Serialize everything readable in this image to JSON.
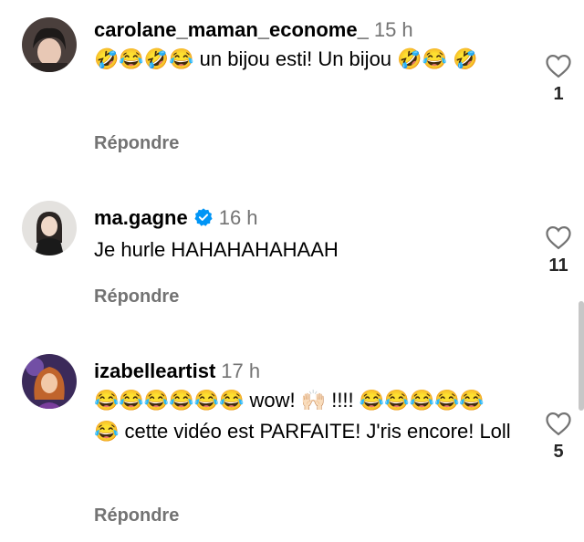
{
  "comments": [
    {
      "username": "carolane_maman_econome_",
      "time": "15 h",
      "text": "🤣😂🤣😂 un bijou esti! Un bijou 🤣😂 🤣",
      "reply_label": "Répondre",
      "likes": "1",
      "verified": false
    },
    {
      "username": "ma.gagne",
      "time": "16 h",
      "text": "Je hurle HAHAHAHAHAAH",
      "reply_label": "Répondre",
      "likes": "11",
      "verified": true
    },
    {
      "username": "izabelleartist",
      "time": "17 h",
      "text": "😂😂😂😂😂😂 wow! 🙌🏻 !!!! 😂😂😂😂😂 😂 cette vidéo est PARFAITE! J'ris encore! Loll",
      "reply_label": "Répondre",
      "likes": "5",
      "verified": false
    }
  ],
  "colors": {
    "verified_blue": "#0095f6",
    "muted_text": "#737373"
  }
}
